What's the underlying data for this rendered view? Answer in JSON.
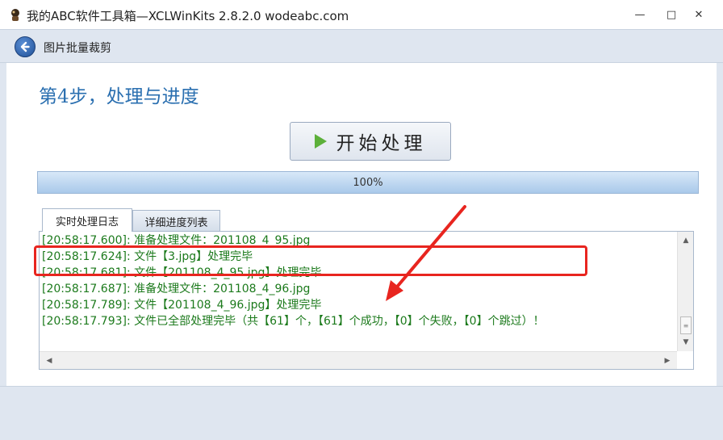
{
  "window": {
    "title": "我的ABC软件工具箱—XCLWinKits 2.8.2.0  wodeabc.com",
    "minimize": "—",
    "maximize": "□",
    "close": "✕"
  },
  "nav": {
    "title": "图片批量裁剪"
  },
  "main": {
    "step_title": "第4步，处理与进度",
    "start_button": "开始处理",
    "progress": {
      "percent": 100,
      "label": "100%"
    },
    "tabs": [
      {
        "label": "实时处理日志",
        "active": true
      },
      {
        "label": "详细进度列表",
        "active": false
      }
    ],
    "log": [
      "[20:58:17.600]: 准备处理文件：201108_4_95.jpg",
      "[20:58:17.624]: 文件【3.jpg】处理完毕",
      "[20:58:17.681]: 文件【201108_4_95.jpg】处理完毕",
      "[20:58:17.687]: 准备处理文件：201108_4_96.jpg",
      "[20:58:17.789]: 文件【201108_4_96.jpg】处理完毕",
      "[20:58:17.793]: 文件已全部处理完毕（共【61】个，【61】个成功，【0】个失败，【0】个跳过）！"
    ]
  },
  "colors": {
    "accent_title": "#2a6fb0",
    "log_text": "#1c7a1c",
    "annotation": "#e8251f",
    "play": "#5cb03a"
  },
  "icons": {
    "app": "app-logo-icon",
    "back": "back-arrow-icon",
    "start": "play-icon"
  }
}
